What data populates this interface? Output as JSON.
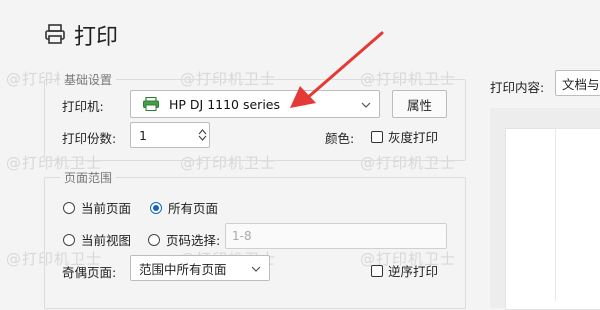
{
  "dialog": {
    "title": "打印",
    "title_icon": "printer-icon"
  },
  "basic": {
    "legend": "基础设置",
    "printer_label": "打印机:",
    "printer_value": "HP DJ 1110 series",
    "printer_icon": "printer-icon",
    "properties_button": "属性",
    "copies_label": "打印份数:",
    "copies_value": "1",
    "color_label": "颜色:",
    "grayscale_label": "灰度打印",
    "grayscale_checked": false
  },
  "range": {
    "legend": "页面范围",
    "current_page": "当前页面",
    "all_pages": "所有页面",
    "current_view": "当前视图",
    "page_select": "页码选择:",
    "page_select_placeholder": "1-8",
    "selected": "all_pages",
    "odd_even_label": "奇偶页面:",
    "odd_even_value": "范围中所有页面",
    "reverse_label": "逆序打印",
    "reverse_checked": false
  },
  "right": {
    "content_label": "打印内容:",
    "content_value": "文档与"
  },
  "watermark": {
    "text": "@打印机卫士"
  },
  "colors": {
    "arrow": "#e53935",
    "accent": "#1565c0",
    "printer_icon_green": "#2e7d32"
  }
}
